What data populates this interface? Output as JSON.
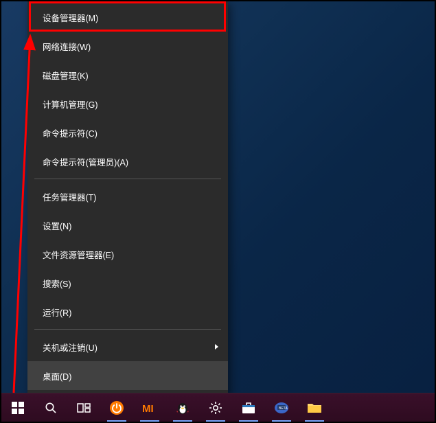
{
  "menu": {
    "items": [
      {
        "label": "设备管理器(M)"
      },
      {
        "label": "网络连接(W)"
      },
      {
        "label": "磁盘管理(K)"
      },
      {
        "label": "计算机管理(G)"
      },
      {
        "label": "命令提示符(C)"
      },
      {
        "label": "命令提示符(管理员)(A)"
      },
      {
        "sep": true
      },
      {
        "label": "任务管理器(T)"
      },
      {
        "label": "设置(N)"
      },
      {
        "label": "文件资源管理器(E)"
      },
      {
        "label": "搜索(S)"
      },
      {
        "label": "运行(R)"
      },
      {
        "sep": true
      },
      {
        "label": "关机或注销(U)",
        "submenu": true
      },
      {
        "label": "桌面(D)",
        "hovered": true
      }
    ]
  },
  "taskbar": {
    "start_label": "开始",
    "items": [
      {
        "name": "search-icon",
        "glyph": "search"
      },
      {
        "name": "task-view-icon",
        "glyph": "taskview"
      },
      {
        "name": "power-icon",
        "glyph": "power"
      },
      {
        "name": "mi-icon",
        "glyph": "mi"
      },
      {
        "name": "qq-icon",
        "glyph": "qq"
      },
      {
        "name": "settings-icon",
        "glyph": "gear"
      },
      {
        "name": "store-icon",
        "glyph": "store"
      },
      {
        "name": "monitor-icon",
        "glyph": "monitor"
      },
      {
        "name": "folder-icon",
        "glyph": "folder"
      }
    ]
  },
  "annotation": {
    "highlight_target": "设备管理器(M)",
    "arrow_color": "#f00"
  }
}
